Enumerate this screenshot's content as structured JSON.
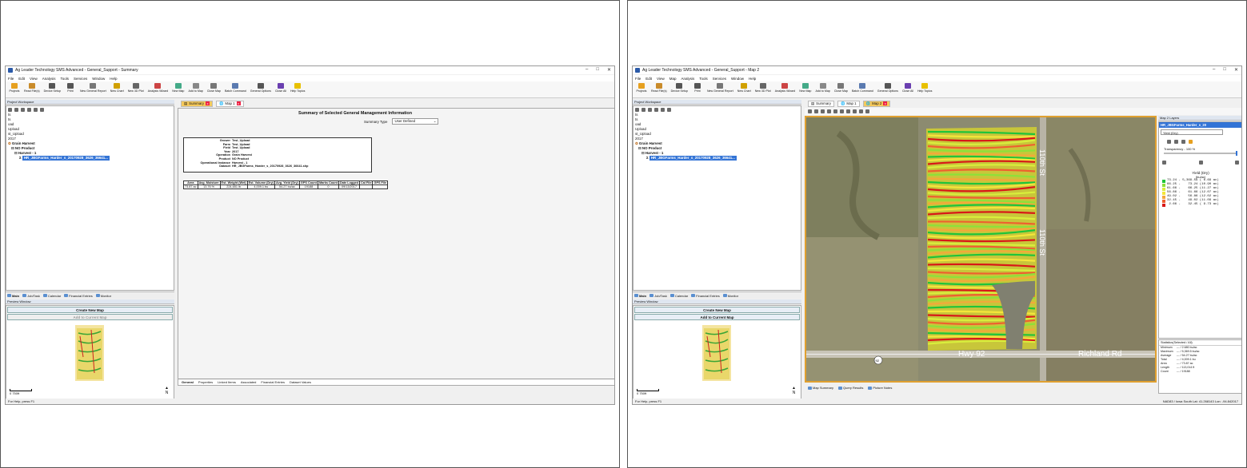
{
  "left": {
    "title": "Ag Leader Technology SMS Advanced - General_Support - Summary",
    "menu": [
      "File",
      "Edit",
      "View",
      "Analysis",
      "Tools",
      "Services",
      "Window",
      "Help"
    ],
    "toolbar": [
      "Projects",
      "Read File(s)",
      "Device Setup",
      "Print",
      "New General Report",
      "New Chart",
      "New 3D Plot",
      "Analysis Wizard",
      "New Map",
      "Add to Map",
      "Close Map",
      "Batch Command",
      "General Options",
      "Close All",
      "Help Topics"
    ],
    "workspace_title": "Project Workspace",
    "tree": [
      "ts",
      "ts",
      "oad",
      "Upload",
      "st_Upload",
      "2017",
      "Grain Harvest",
      "NO Product",
      "Harvest - 1",
      "HR_JBGFarms_Harder_s_20170928_3626_36641..."
    ],
    "ws_tabs": [
      "Main",
      "Job/Task",
      "Calendar",
      "Financial Entries",
      "Monitor"
    ],
    "preview_title": "Preview Window",
    "create_map": "Create New Map",
    "add_current": "Add to Current Map",
    "scale": "0      750ft",
    "north": "N",
    "status": "For Help, press F1",
    "doc_tabs": [
      "Summary",
      "Map 1"
    ],
    "report_title": "Summary of Selected General Management Information",
    "summary_type_label": "Summary Type",
    "summary_type_value": "User Defined",
    "info": [
      [
        "Grower",
        "Test_Upload"
      ],
      [
        "Farm",
        "Test_Upload"
      ],
      [
        "Field",
        "Test_Upload"
      ],
      [
        "Year",
        "2017"
      ],
      [
        "Operation",
        "Grain Harvest"
      ],
      [
        "Product",
        "NO Product"
      ],
      [
        "Operational Instance",
        "Harvest - 1"
      ],
      [
        "Dataset",
        "HR_JBGFarms_Harder_s_20170928_3626_36641.shp"
      ]
    ],
    "table_headers": [
      "Area",
      "Avg. Moisture",
      "Est. Weight (Wet)",
      "Est. Volume (Dry)",
      "Avg. Yield (Dry)",
      "GPS Count",
      "Marks Count",
      "Date Logged",
      "Cal File",
      "GPS File"
    ],
    "table_row": [
      "73.87 ac",
      "13.76 %",
      "224,651 lb",
      "4,009.1 bu",
      "54.27 bu/ac",
      "19188",
      "0",
      "09/13/2017",
      "",
      ""
    ],
    "bottom_tabs": [
      "General",
      "Properties",
      "Linked Items",
      "Associated",
      "Financial Entries",
      "Dataset Values"
    ]
  },
  "right": {
    "title": "Ag Leader Technology SMS Advanced - General_Support - Map 2",
    "menu": [
      "File",
      "Edit",
      "View",
      "Map",
      "Analysis",
      "Tools",
      "Services",
      "Window",
      "Help"
    ],
    "doc_tabs": [
      "Summary",
      "Map 1",
      "Map 2"
    ],
    "layers_title": "Map 2 Layers",
    "layer_name": "HR_JBGFarms_Harder_s_20",
    "layer_attr": "Yield (Dry)",
    "transparency": "Transparency - 100 %",
    "legend_title": "Yield (Dry)",
    "legend_unit": "(bu/ac)",
    "legend": [
      {
        "range": "73.24 - 5,369.59 ( 6.69 ac)",
        "color": "#1fc43a"
      },
      {
        "range": "66.25 -    73.24 (10.90 ac)",
        "color": "#8ee03a"
      },
      {
        "range": "61.66 -    66.25 (11.27 ac)",
        "color": "#d9ee3c"
      },
      {
        "range": "56.86 -    61.66 (12.07 ac)",
        "color": "#f4e63a"
      },
      {
        "range": "49.02 -    56.86 (12.02 ac)",
        "color": "#f4a83a"
      },
      {
        "range": "32.45 -    49.02 (11.09 ac)",
        "color": "#ee6030"
      },
      {
        "range": " 2.66 -    32.45 ( 9.73 ac)",
        "color": "#d81818"
      }
    ],
    "stats_title": "Statistics(Selected / All)",
    "stats": [
      [
        "Minimum",
        "--- / 2.680 bu/ac"
      ],
      [
        "Maximum",
        "--- / 5,369.5 bu/ac"
      ],
      [
        "Average",
        "--- / 54.27 bu/ac"
      ],
      [
        "Total",
        "--- / 4,009.1 bu"
      ],
      [
        "Area",
        "--- / 73.87 ac"
      ],
      [
        "Length",
        "--- / 113,014 ft"
      ],
      [
        "Count",
        "--- / 19188"
      ]
    ],
    "road_labels": {
      "hwy": "Hwy 92",
      "richland": "Richland Rd",
      "n_road": "110th St",
      "road_shield": "92"
    },
    "map_tabs": [
      "Map Summary",
      "Query Results",
      "Picture Notes"
    ],
    "coords": "NAD83 / Iowa South   Lat: 41.268143  Lon: -94.842017"
  }
}
